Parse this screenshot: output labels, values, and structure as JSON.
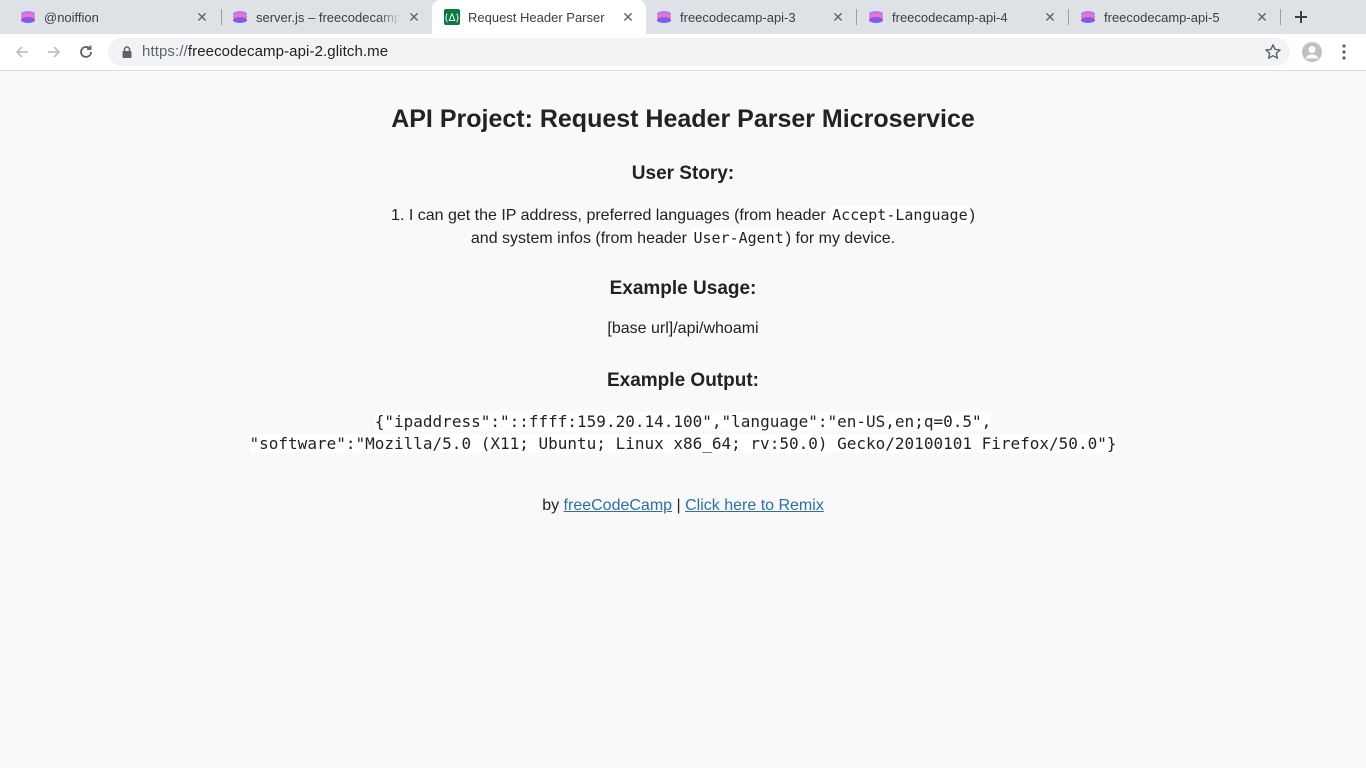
{
  "browser": {
    "tabs": [
      {
        "title": "@noiffion",
        "favicon": "glitch-icon",
        "active": false
      },
      {
        "title": "server.js – freecodecamp",
        "favicon": "glitch-icon",
        "active": false
      },
      {
        "title": "Request Header Parser",
        "favicon": "fcc-icon",
        "active": true
      },
      {
        "title": "freecodecamp-api-3",
        "favicon": "glitch-icon",
        "active": false
      },
      {
        "title": "freecodecamp-api-4",
        "favicon": "glitch-icon",
        "active": false
      },
      {
        "title": "freecodecamp-api-5",
        "favicon": "glitch-icon",
        "active": false
      }
    ],
    "close_glyph": "✕",
    "new_tab_icon": "plus-icon",
    "url_scheme": "https://",
    "url_host": "freecodecamp-api-2.glitch.me"
  },
  "page": {
    "title": "API Project: Request Header Parser Microservice",
    "user_story_heading": "User Story:",
    "story_number": "1.",
    "story_text_1": "I can get the IP address, preferred languages (from header",
    "story_code_1": "Accept-Language",
    "story_text_2": ")",
    "story_text_3": "and system infos (from header",
    "story_code_2": "User-Agent",
    "story_text_4": ") for my device.",
    "example_usage_heading": "Example Usage:",
    "example_usage": "[base url]/api/whoami",
    "example_output_heading": "Example Output:",
    "example_output_line1": "{\"ipaddress\":\"::ffff:159.20.14.100\",\"language\":\"en-US,en;q=0.5\",",
    "example_output_line2": "\"software\":\"Mozilla/5.0 (X11; Ubuntu; Linux x86_64; rv:50.0) Gecko/20100101 Firefox/50.0\"}",
    "footer_by": "by",
    "footer_link1": "freeCodeCamp",
    "footer_sep": "|",
    "footer_link2": "Click here to Remix"
  },
  "colors": {
    "tabstrip": "#dee1e6",
    "page_bg": "#f9f9f9",
    "link": "#2a6fa8",
    "glitch_purple": "#9d5cf5",
    "fcc_green": "#0a7b3e"
  }
}
